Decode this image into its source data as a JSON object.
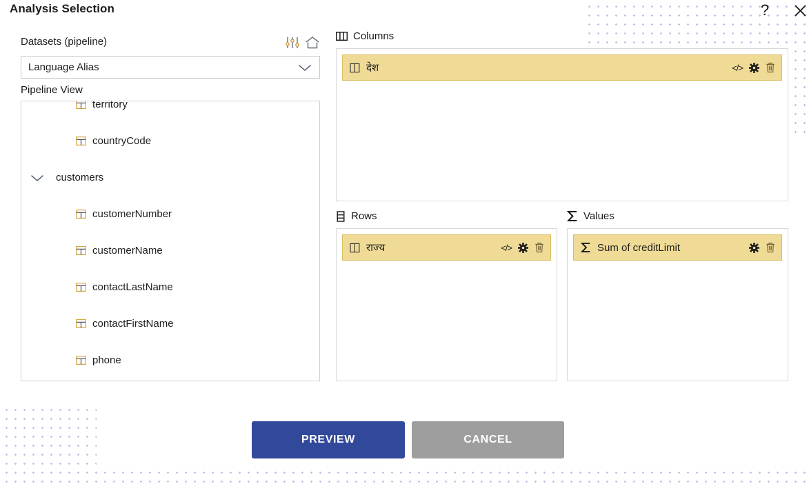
{
  "header": {
    "title": "Analysis Selection",
    "help_icon": "question-mark-icon",
    "close_icon": "close-icon"
  },
  "left_panel": {
    "datasets_label": "Datasets (pipeline)",
    "sliders_icon": "sliders-icon",
    "home_icon": "home-icon",
    "dataset_select": {
      "value": "Language Alias",
      "chevron_icon": "chevron-down-icon"
    },
    "pipeline_label": "Pipeline View",
    "tree": [
      {
        "label": "territory",
        "type": "field",
        "icon": "table-field-icon"
      },
      {
        "label": "countryCode",
        "type": "field",
        "icon": "table-field-icon"
      },
      {
        "label": "customers",
        "type": "group",
        "icon": "chevron-down-icon",
        "expanded": true
      },
      {
        "label": "customerNumber",
        "type": "field",
        "icon": "table-field-icon"
      },
      {
        "label": "customerName",
        "type": "field",
        "icon": "table-field-icon"
      },
      {
        "label": "contactLastName",
        "type": "field",
        "icon": "table-field-icon"
      },
      {
        "label": "contactFirstName",
        "type": "field",
        "icon": "table-field-icon"
      },
      {
        "label": "phone",
        "type": "field",
        "icon": "table-field-icon"
      }
    ]
  },
  "zones": {
    "columns": {
      "label": "Columns",
      "icon": "columns-icon",
      "chips": [
        {
          "label": "देश",
          "icon": "column-field-icon",
          "actions": [
            "code-icon",
            "gear-icon",
            "trash-icon"
          ]
        }
      ]
    },
    "rows": {
      "label": "Rows",
      "icon": "rows-icon",
      "chips": [
        {
          "label": "राज्य",
          "icon": "column-field-icon",
          "actions": [
            "code-icon",
            "gear-icon",
            "trash-icon"
          ]
        }
      ]
    },
    "values": {
      "label": "Values",
      "icon": "sigma-icon",
      "chips": [
        {
          "label": "Sum of creditLimit",
          "icon": "sigma-icon",
          "actions": [
            "gear-icon",
            "trash-icon"
          ]
        }
      ]
    }
  },
  "footer": {
    "preview_label": "PREVIEW",
    "cancel_label": "CANCEL"
  },
  "colors": {
    "primary_button": "#32499b",
    "cancel_button": "#9e9e9e",
    "chip_fill": "#efdb96",
    "chip_border": "#d9bf63",
    "dot_pattern": "#b9c0e8"
  }
}
